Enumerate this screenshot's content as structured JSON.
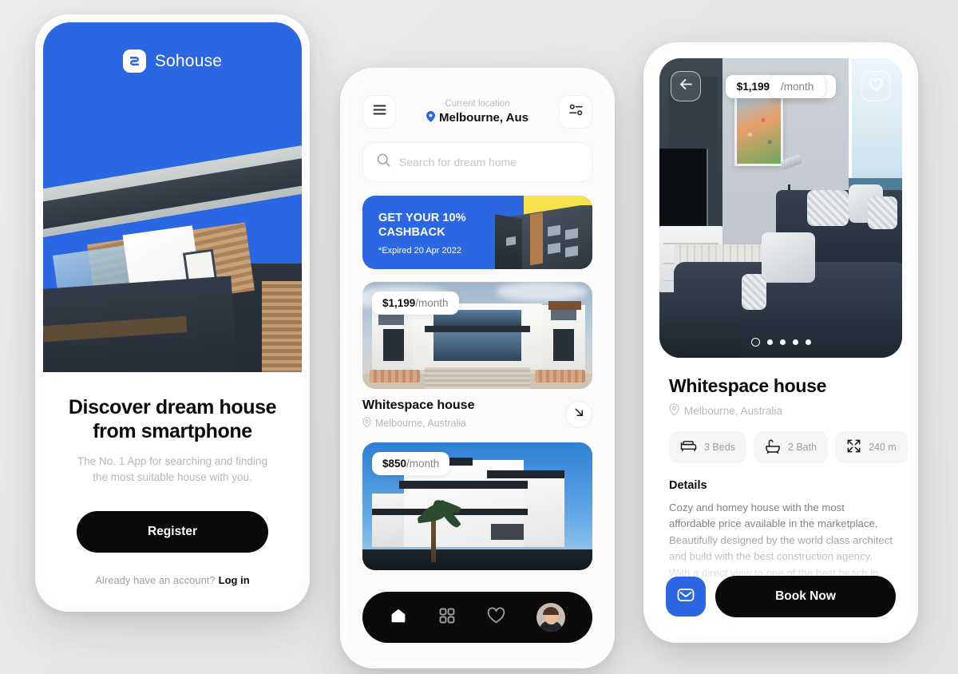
{
  "brand": {
    "name": "Sohouse",
    "logo_icon": "sohouse-logo-icon",
    "accent_blue": "#2B66E3"
  },
  "onboarding": {
    "title_line1": "Discover dream house",
    "title_line2": "from smartphone",
    "subtitle_line1": "The No. 1 App for searching and finding",
    "subtitle_line2": "the most suitable house with you.",
    "register_label": "Register",
    "account_prompt": "Already have an account?",
    "login_label": "Log in"
  },
  "home": {
    "menu_icon": "hamburger-menu-icon",
    "filter_icon": "filter-sliders-icon",
    "location_label": "Current location",
    "location_value": "Melbourne, Aus",
    "location_pin_icon": "location-pin-icon",
    "search": {
      "icon": "search-icon",
      "placeholder": "Search for dream home",
      "value": ""
    },
    "promo": {
      "headline_line1": "GET YOUR 10%",
      "headline_line2": "CASHBACK",
      "expiry": "*Expired 20 Apr 2022",
      "accent_yellow": "#F7E24E"
    },
    "listings": [
      {
        "price": "$1,199",
        "price_unit": "/month",
        "title": "Whitespace house",
        "location": "Melbourne, Australia",
        "location_icon": "location-pin-icon",
        "action_icon": "arrow-down-right-icon"
      },
      {
        "price": "$850",
        "price_unit": "/month",
        "title": "",
        "location": "",
        "location_icon": "location-pin-icon",
        "action_icon": "arrow-down-right-icon"
      }
    ],
    "tabs": [
      {
        "name": "home",
        "icon": "home-icon",
        "active": true
      },
      {
        "name": "explore",
        "icon": "grid-icon",
        "active": false
      },
      {
        "name": "favorites",
        "icon": "heart-icon",
        "active": false
      },
      {
        "name": "profile",
        "icon": "avatar-icon",
        "active": false
      }
    ]
  },
  "detail": {
    "back_icon": "arrow-left-icon",
    "favorite_icon": "heart-icon",
    "price": "$1,199",
    "price_unit": "/month",
    "gallery_dots": 5,
    "gallery_active_index": 0,
    "title": "Whitespace house",
    "location": "Melbourne, Australia",
    "location_icon": "location-pin-icon",
    "specs": [
      {
        "icon": "bed-icon",
        "label": "3 Beds"
      },
      {
        "icon": "bath-icon",
        "label": "2 Bath"
      },
      {
        "icon": "expand-icon",
        "label": "240 m"
      }
    ],
    "details_heading": "Details",
    "details_body": "Cozy and homey house with the most affordable price available in the marketplace. Beautifully designed by the world class architect and build with the best construction agency. With a direct view to one of the best beach in Australia and sunset as a bonus. This house have a modern American style on top. You will also get a large",
    "message_icon": "envelope-icon",
    "book_label": "Book Now"
  }
}
